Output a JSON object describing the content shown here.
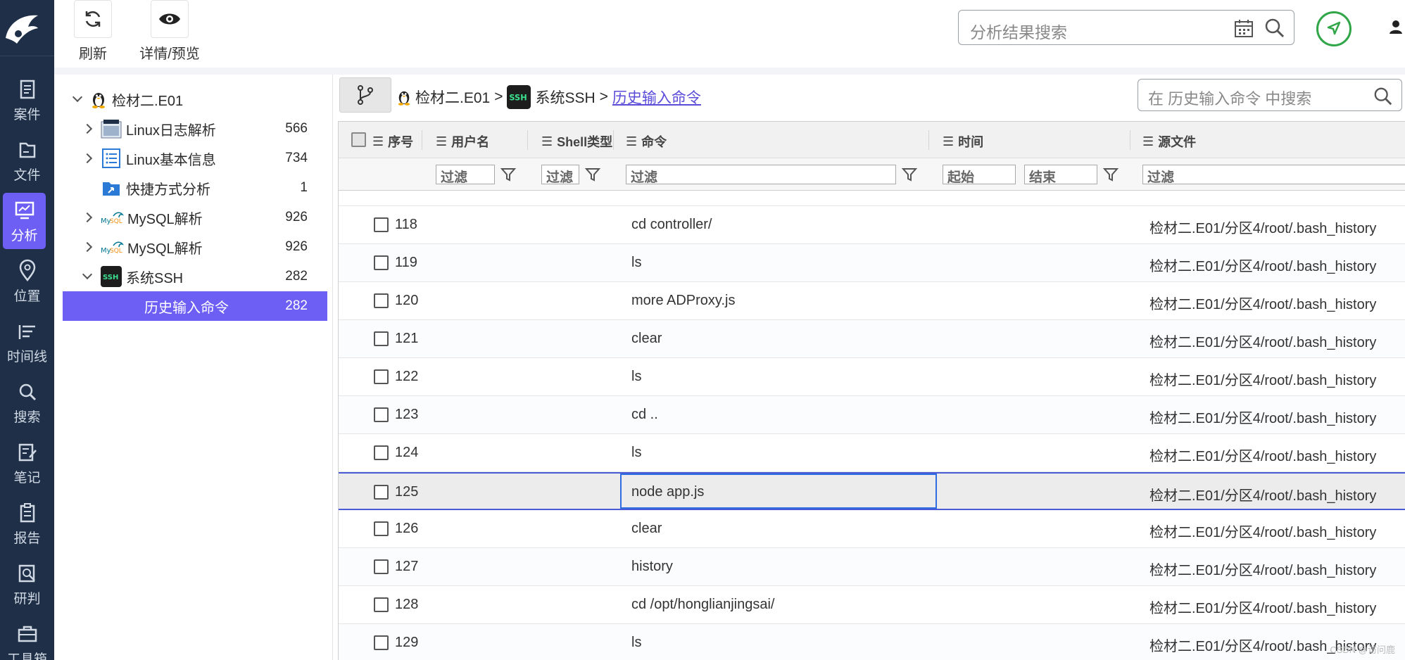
{
  "toolbar": {
    "refresh_label": "刷新",
    "detail_label": "详情/预览",
    "search_placeholder": "分析结果搜索"
  },
  "nav": {
    "items": [
      {
        "label": "案件",
        "icon": "case-icon"
      },
      {
        "label": "文件",
        "icon": "folder-icon"
      },
      {
        "label": "分析",
        "icon": "analysis-icon",
        "active": true
      },
      {
        "label": "位置",
        "icon": "location-icon"
      },
      {
        "label": "时间线",
        "icon": "timeline-icon"
      },
      {
        "label": "搜索",
        "icon": "search-icon"
      },
      {
        "label": "笔记",
        "icon": "note-icon"
      },
      {
        "label": "报告",
        "icon": "report-icon"
      },
      {
        "label": "研判",
        "icon": "judge-icon"
      },
      {
        "label": "工具箱",
        "icon": "toolbox-icon"
      }
    ]
  },
  "tree": {
    "root_label": "检材二.E01",
    "items": [
      {
        "label": "Linux日志解析",
        "count": "566"
      },
      {
        "label": "Linux基本信息",
        "count": "734"
      },
      {
        "label": "快捷方式分析",
        "count": "1"
      },
      {
        "label": "MySQL解析",
        "count": "926"
      },
      {
        "label": "MySQL解析",
        "count": "926"
      },
      {
        "label": "系统SSH",
        "count": "282"
      },
      {
        "label": "历史输入命令",
        "count": "282"
      }
    ]
  },
  "breadcrumb": {
    "root": "检材二.E01",
    "mid": "系统SSH",
    "current": "历史输入命令",
    "sep": ">",
    "search_placeholder": "在 历史输入命令 中搜索"
  },
  "grid": {
    "headers": {
      "index": "序号",
      "username": "用户名",
      "shell": "Shell类型",
      "command": "命令",
      "time": "时间",
      "source": "源文件"
    },
    "filter": {
      "placeholder": "过滤",
      "start": "起始",
      "end": "结束"
    },
    "rows": [
      {
        "index": "118",
        "command": "cd controller/",
        "source": "检材二.E01/分区4/root/.bash_history"
      },
      {
        "index": "119",
        "command": "ls",
        "source": "检材二.E01/分区4/root/.bash_history"
      },
      {
        "index": "120",
        "command": "more ADProxy.js",
        "source": "检材二.E01/分区4/root/.bash_history"
      },
      {
        "index": "121",
        "command": "clear",
        "source": "检材二.E01/分区4/root/.bash_history"
      },
      {
        "index": "122",
        "command": "ls",
        "source": "检材二.E01/分区4/root/.bash_history"
      },
      {
        "index": "123",
        "command": "cd ..",
        "source": "检材二.E01/分区4/root/.bash_history"
      },
      {
        "index": "124",
        "command": "ls",
        "source": "检材二.E01/分区4/root/.bash_history"
      },
      {
        "index": "125",
        "command": "node app.js",
        "source": "检材二.E01/分区4/root/.bash_history",
        "selected": true
      },
      {
        "index": "126",
        "command": "clear",
        "source": "检材二.E01/分区4/root/.bash_history"
      },
      {
        "index": "127",
        "command": "history",
        "source": "检材二.E01/分区4/root/.bash_history"
      },
      {
        "index": "128",
        "command": "cd /opt/honglianjingsai/",
        "source": "检材二.E01/分区4/root/.bash_history"
      },
      {
        "index": "129",
        "command": "ls",
        "source": "检材二.E01/分区4/root/.bash_history"
      }
    ]
  },
  "watermark": "CSDN @访问鹿",
  "colors": {
    "nav_bg": "#1e2f47",
    "accent": "#6d5ff4",
    "gps_green": "#31a648",
    "selection_border": "#2f6de1"
  }
}
